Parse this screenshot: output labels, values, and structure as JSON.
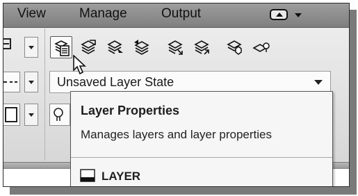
{
  "menu": {
    "items": [
      "View",
      "Manage",
      "Output"
    ],
    "workspace_dropdown_icon": "eject-dropdown-icon"
  },
  "ribbon": {
    "layer_tools": [
      "layer-properties-icon",
      "layer-state-icon",
      "layer-make-current-icon",
      "layer-previous-icon",
      "layer-match-icon",
      "layer-change-icon",
      "layer-isolate-icon",
      "layer-off-icon"
    ],
    "layer_state_value": "Unsaved Layer State"
  },
  "tooltip": {
    "title": "Layer Properties",
    "description": "Manages layers and layer properties",
    "command": "LAYER",
    "command_icon": "command-line-icon"
  },
  "colors": {
    "menubar": "#8e8e8e",
    "ribbon": "#e2e2e2",
    "tooltip_bg": "#f6f6f6"
  }
}
